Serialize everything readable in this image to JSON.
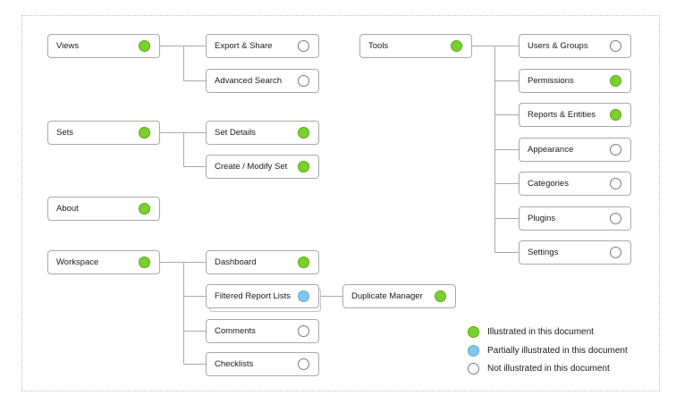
{
  "colors": {
    "illustrated": "#79d12c",
    "partial": "#7fc7ef",
    "not_illustrated": "#ffffff",
    "line": "#a9a9a9"
  },
  "nodes": {
    "views": {
      "label": "Views",
      "status": "illustrated"
    },
    "export_share": {
      "label": "Export & Share",
      "status": "not_illustrated"
    },
    "advanced_search": {
      "label": "Advanced Search",
      "status": "not_illustrated"
    },
    "sets": {
      "label": "Sets",
      "status": "illustrated"
    },
    "set_details": {
      "label": "Set Details",
      "status": "illustrated"
    },
    "create_modify_set": {
      "label": "Create / Modify Set",
      "status": "illustrated"
    },
    "about": {
      "label": "About",
      "status": "illustrated"
    },
    "workspace": {
      "label": "Workspace",
      "status": "illustrated"
    },
    "dashboard": {
      "label": "Dashboard",
      "status": "illustrated"
    },
    "filtered_report_lists": {
      "label": "Filtered Report Lists",
      "status": "partial"
    },
    "duplicate_manager": {
      "label": "Duplicate Manager",
      "status": "illustrated"
    },
    "comments": {
      "label": "Comments",
      "status": "not_illustrated"
    },
    "checklists": {
      "label": "Checklists",
      "status": "not_illustrated"
    },
    "tools": {
      "label": "Tools",
      "status": "illustrated"
    },
    "users_groups": {
      "label": "Users & Groups",
      "status": "not_illustrated"
    },
    "permissions": {
      "label": "Permissions",
      "status": "illustrated"
    },
    "reports_entities": {
      "label": "Reports & Entities",
      "status": "illustrated"
    },
    "appearance": {
      "label": "Appearance",
      "status": "not_illustrated"
    },
    "categories": {
      "label": "Categories",
      "status": "not_illustrated"
    },
    "plugins": {
      "label": "Plugins",
      "status": "not_illustrated"
    },
    "settings": {
      "label": "Settings",
      "status": "not_illustrated"
    }
  },
  "legend": {
    "illustrated": "Illustrated in this document",
    "partial": "Partially illustrated in this document",
    "not_illustrated": "Not illustrated in this document"
  }
}
